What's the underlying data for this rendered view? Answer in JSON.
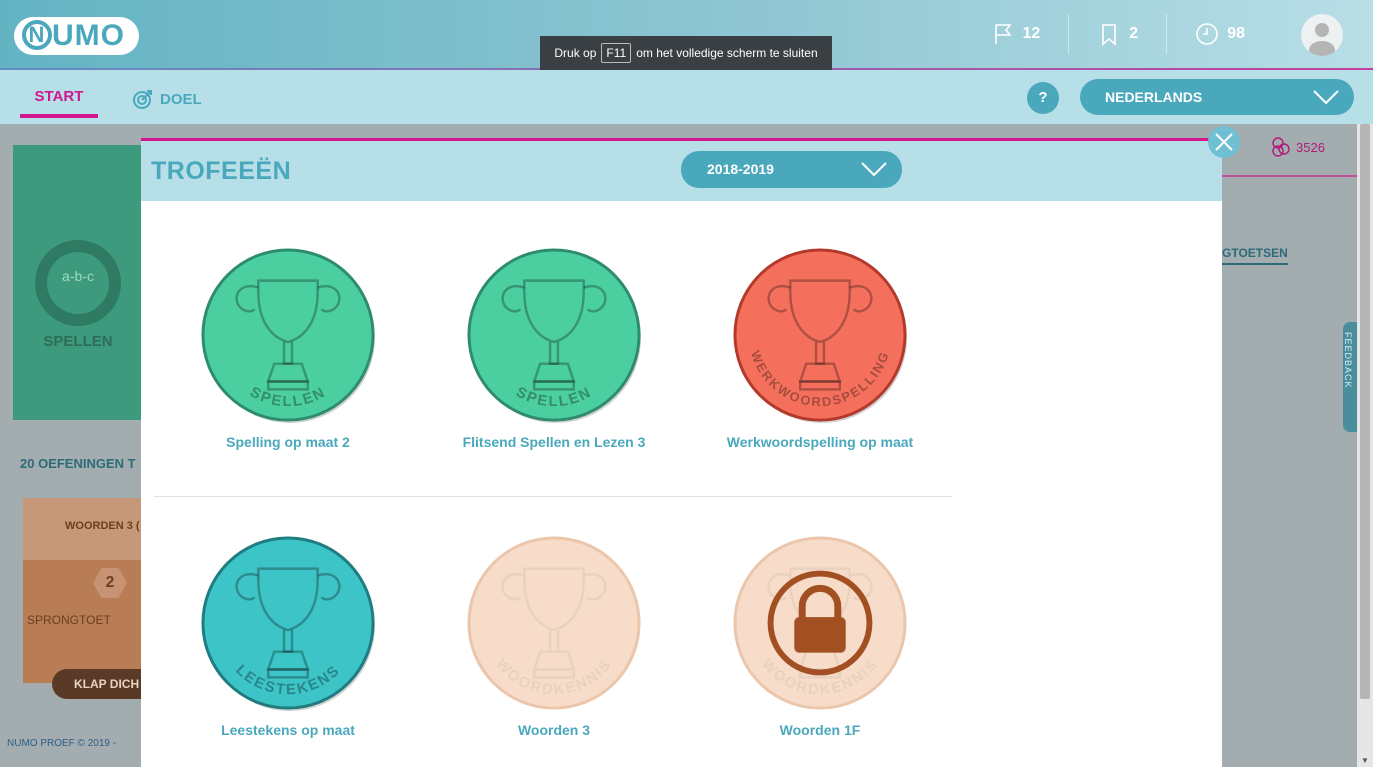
{
  "header": {
    "logo": "NUMO",
    "fullscreen_tip": {
      "prefix": "Druk op",
      "key": "F11",
      "suffix": "om het volledige scherm te sluiten"
    },
    "stats": {
      "flags": "12",
      "bookmarks": "2",
      "time": "98"
    }
  },
  "nav": {
    "tabs": [
      {
        "label": "START"
      },
      {
        "label": "DOEL"
      }
    ],
    "help_label": "?",
    "language": "NEDERLANDS"
  },
  "background": {
    "card_spellen_label": "SPELLEN",
    "card_spellen_icon_text": "a-b-c",
    "oefeningen_label": "20 OEFENINGEN T",
    "woorden_card_title": "WOORDEN 3 (",
    "woorden_card_number": "2",
    "woorden_card_sub": "SPRONGTOET",
    "klap_button": "KLAP DICH",
    "footer": "NUMO PROEF © 2019 - ",
    "counter": "3526",
    "gtoetsen": "GTOETSEN",
    "feedback": "FEEDBACK"
  },
  "modal": {
    "title": "TROFEEËN",
    "year": "2018-2019",
    "trophies": [
      {
        "name": "Spelling op maat 2",
        "arc": "SPELLEN",
        "status": "earned",
        "color": "#4ccfa0",
        "border": "#2e8c6c",
        "icon": "trophy-icon"
      },
      {
        "name": "Flitsend Spellen en Lezen 3",
        "arc": "SPELLEN",
        "status": "earned",
        "color": "#4ccfa0",
        "border": "#2e8c6c",
        "icon": "trophy-icon"
      },
      {
        "name": "Werkwoordspelling op maat",
        "arc": "WERKWOORDSPELLING",
        "status": "earned",
        "color": "#f5705c",
        "border": "#b33a2b",
        "icon": "trophy-icon"
      },
      {
        "name": "Leestekens op maat",
        "arc": "LEESTEKENS",
        "status": "earned",
        "color": "#3dc4c6",
        "border": "#1f7c80",
        "icon": "trophy-icon"
      },
      {
        "name": "Woorden 3",
        "arc": "WOORDKENNIS",
        "status": "faded",
        "color": "#f6dcc9",
        "border": "#ebc6ab",
        "icon": "trophy-icon"
      },
      {
        "name": "Woorden 1F",
        "arc": "WOORDKENNIS",
        "status": "locked",
        "color": "#f6dcc9",
        "border": "#ebc6ab",
        "icon": "lock-icon"
      }
    ]
  }
}
